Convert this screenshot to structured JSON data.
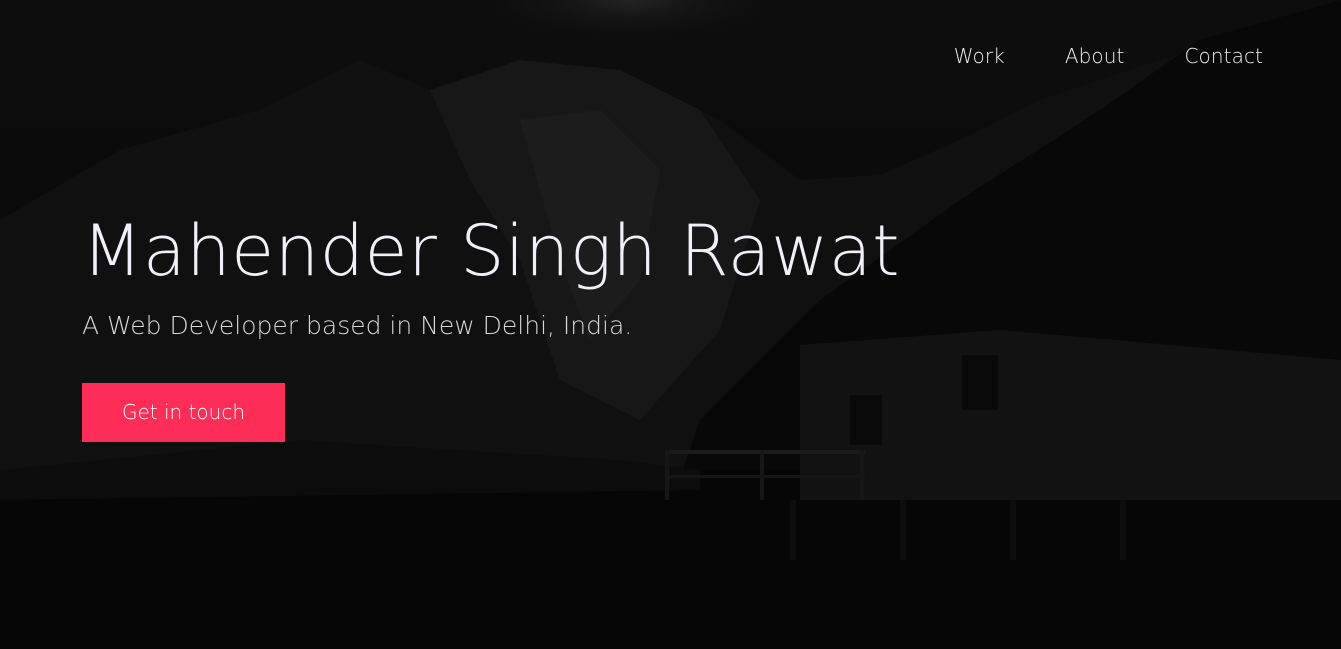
{
  "nav": {
    "items": [
      {
        "label": "Work"
      },
      {
        "label": "About"
      },
      {
        "label": "Contact"
      }
    ]
  },
  "hero": {
    "title": "Mahender Singh Rawat",
    "subtitle": "A Web Developer based in New Delhi, India.",
    "cta_label": "Get in touch",
    "background": "night-mountain-lake-cabin-photo"
  },
  "colors": {
    "accent": "#fd2d57",
    "background": "#070707",
    "text": "#f3eff7"
  }
}
